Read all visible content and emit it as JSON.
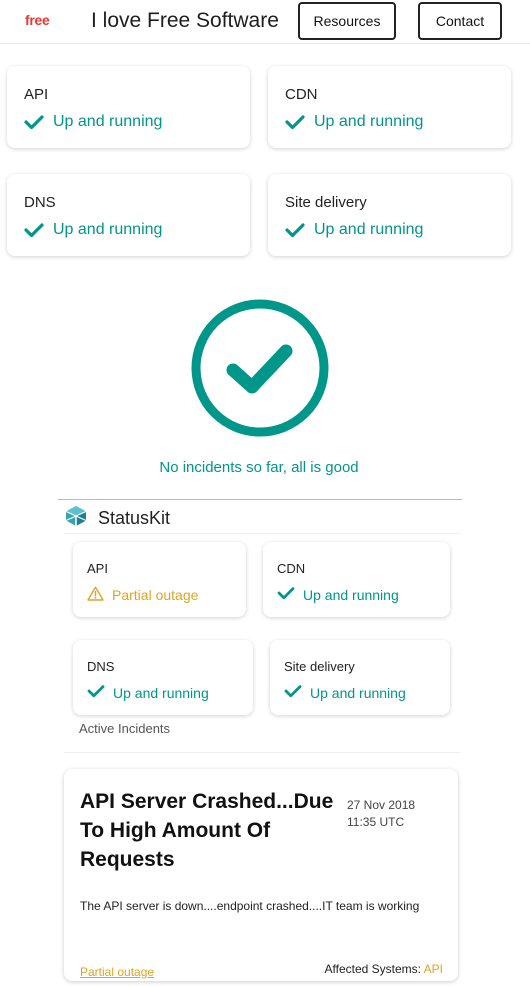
{
  "header": {
    "logo_text": "free",
    "title": "I love Free Software",
    "nav": [
      {
        "label": "Resources"
      },
      {
        "label": "Contact"
      }
    ]
  },
  "top_services": [
    {
      "name": "API",
      "status": "Up and running",
      "state": "ok"
    },
    {
      "name": "CDN",
      "status": "Up and running",
      "state": "ok"
    },
    {
      "name": "DNS",
      "status": "Up and running",
      "state": "ok"
    },
    {
      "name": "Site delivery",
      "status": "Up and running",
      "state": "ok"
    }
  ],
  "banner": {
    "icon": "check-circle-icon",
    "message": "No incidents so far, all is good"
  },
  "widget": {
    "brand": "StatusKit",
    "brand_icon": "statuskit-logo-icon",
    "services": [
      {
        "name": "API",
        "status": "Partial outage",
        "state": "warn"
      },
      {
        "name": "CDN",
        "status": "Up and running",
        "state": "ok"
      },
      {
        "name": "DNS",
        "status": "Up and running",
        "state": "ok"
      },
      {
        "name": "Site delivery",
        "status": "Up and running",
        "state": "ok"
      }
    ],
    "active_incidents_label": "Active Incidents",
    "incidents": [
      {
        "title": "API Server Crashed...Due To High Amount Of Requests",
        "date": "27 Nov 2018",
        "time": "11:35 UTC",
        "description": "The API server is down....endpoint crashed....IT team is working",
        "status": "Partial outage",
        "affected_label": "Affected Systems:",
        "affected_systems": "API"
      }
    ]
  },
  "colors": {
    "ok": "#00968a",
    "warn": "#e0a422",
    "logo": "#e53935"
  }
}
